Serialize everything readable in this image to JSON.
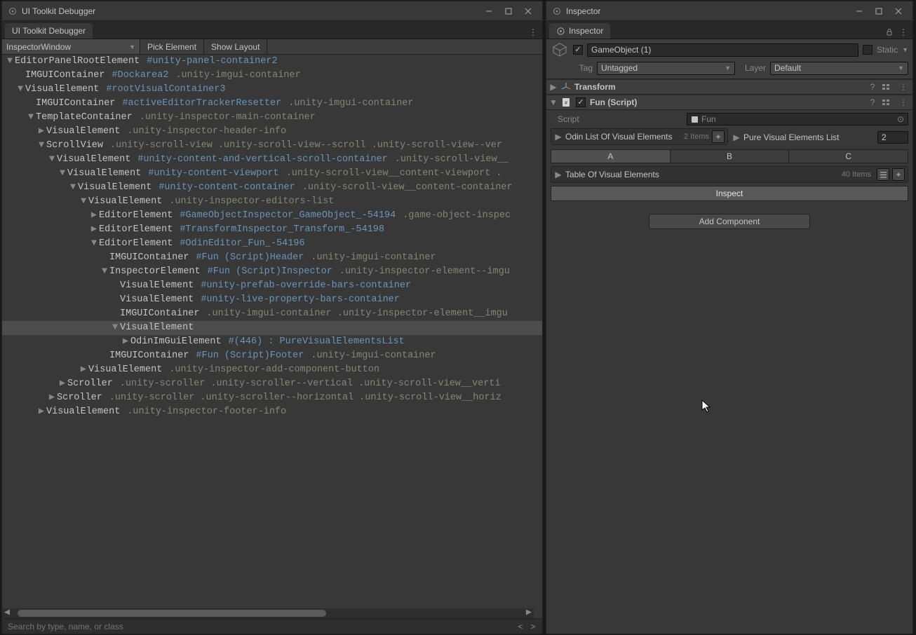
{
  "left": {
    "title": "UI Toolkit Debugger",
    "tab": "UI Toolkit Debugger",
    "toolbar": {
      "target": "InspectorWindow",
      "pick": "Pick Element",
      "show": "Show Layout"
    },
    "search_placeholder": "Search by type, name, or class",
    "tree": [
      {
        "d": 0,
        "f": "▼",
        "n": "EditorPanelRootElement",
        "id": "#unity-panel-container2"
      },
      {
        "d": 1,
        "f": "",
        "n": "IMGUIContainer",
        "id": "#Dockarea2",
        "c": ".unity-imgui-container"
      },
      {
        "d": 1,
        "f": "▼",
        "n": "VisualElement",
        "id": "#rootVisualContainer3"
      },
      {
        "d": 2,
        "f": "",
        "n": "IMGUIContainer",
        "id": "#activeEditorTrackerResetter",
        "c": ".unity-imgui-container"
      },
      {
        "d": 2,
        "f": "▼",
        "n": "TemplateContainer",
        "c": ".unity-inspector-main-container"
      },
      {
        "d": 3,
        "f": "▶",
        "n": "VisualElement",
        "c": ".unity-inspector-header-info"
      },
      {
        "d": 3,
        "f": "▼",
        "n": "ScrollView",
        "c": ".unity-scroll-view  .unity-scroll-view--scroll  .unity-scroll-view--ver"
      },
      {
        "d": 4,
        "f": "▼",
        "n": "VisualElement",
        "id": "#unity-content-and-vertical-scroll-container",
        "c": ".unity-scroll-view__"
      },
      {
        "d": 5,
        "f": "▼",
        "n": "VisualElement",
        "id": "#unity-content-viewport",
        "c": ".unity-scroll-view__content-viewport  ."
      },
      {
        "d": 6,
        "f": "▼",
        "n": "VisualElement",
        "id": "#unity-content-container",
        "c": ".unity-scroll-view__content-container"
      },
      {
        "d": 7,
        "f": "▼",
        "n": "VisualElement",
        "c": ".unity-inspector-editors-list"
      },
      {
        "d": 8,
        "f": "▶",
        "n": "EditorElement",
        "id": "#GameObjectInspector_GameObject_-54194",
        "c": ".game-object-inspec"
      },
      {
        "d": 8,
        "f": "▶",
        "n": "EditorElement",
        "id": "#TransformInspector_Transform_-54198"
      },
      {
        "d": 8,
        "f": "▼",
        "n": "EditorElement",
        "id": "#OdinEditor_Fun_-54196"
      },
      {
        "d": 9,
        "f": "",
        "n": "IMGUIContainer",
        "id": "#Fun (Script)Header",
        "c": ".unity-imgui-container"
      },
      {
        "d": 9,
        "f": "▼",
        "n": "InspectorElement",
        "id": "#Fun (Script)Inspector",
        "c": ".unity-inspector-element--imgu"
      },
      {
        "d": 10,
        "f": "",
        "n": "VisualElement",
        "id": "#unity-prefab-override-bars-container"
      },
      {
        "d": 10,
        "f": "",
        "n": "VisualElement",
        "id": "#unity-live-property-bars-container"
      },
      {
        "d": 10,
        "f": "",
        "n": "IMGUIContainer",
        "c": ".unity-imgui-container  .unity-inspector-element__imgu"
      },
      {
        "d": 10,
        "f": "▼",
        "n": "VisualElement",
        "sel": true
      },
      {
        "d": 11,
        "f": "▶",
        "n": "OdinImGuiElement",
        "id": "#(446) : PureVisualElementsList"
      },
      {
        "d": 9,
        "f": "",
        "n": "IMGUIContainer",
        "id": "#Fun (Script)Footer",
        "c": ".unity-imgui-container"
      },
      {
        "d": 7,
        "f": "▶",
        "n": "VisualElement",
        "c": ".unity-inspector-add-component-button"
      },
      {
        "d": 5,
        "f": "▶",
        "n": "Scroller",
        "c": ".unity-scroller  .unity-scroller--vertical  .unity-scroll-view__verti"
      },
      {
        "d": 4,
        "f": "▶",
        "n": "Scroller",
        "c": ".unity-scroller  .unity-scroller--horizontal  .unity-scroll-view__horiz"
      },
      {
        "d": 3,
        "f": "▶",
        "n": "VisualElement",
        "c": ".unity-inspector-footer-info"
      }
    ]
  },
  "right": {
    "title": "Inspector",
    "tab": "Inspector",
    "go": {
      "name": "GameObject (1)",
      "enabled": true,
      "static_label": "Static",
      "tag_label": "Tag",
      "tag_value": "Untagged",
      "layer_label": "Layer",
      "layer_value": "Default"
    },
    "transform": {
      "name": "Transform"
    },
    "fun": {
      "name": "Fun (Script)",
      "script_label": "Script",
      "script_value": "Fun",
      "odin_list_label": "Odin List Of Visual Elements",
      "odin_list_count": "2 Items",
      "pure_list_label": "Pure Visual Elements List",
      "pure_list_value": "2",
      "tabs": [
        "A",
        "B",
        "C"
      ],
      "table_label": "Table Of Visual Elements",
      "table_count": "40 Items",
      "inspect": "Inspect"
    },
    "add_component": "Add Component"
  }
}
